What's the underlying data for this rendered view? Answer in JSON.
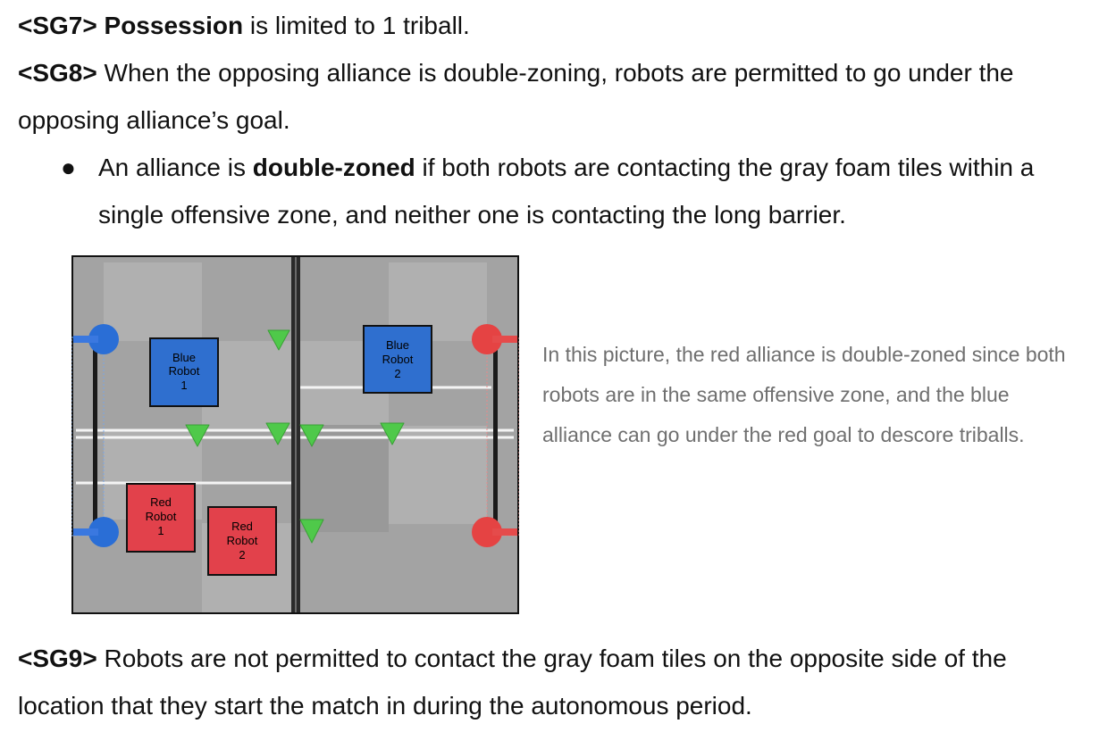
{
  "sg7": {
    "tag": "<SG7>",
    "term": "Possession",
    "text": " is limited to 1 triball."
  },
  "sg8": {
    "tag": "<SG8>",
    "text": " When the opposing alliance is double-zoning, robots are permitted to go under the opposing alliance’s goal."
  },
  "bullet": {
    "symbol": "●",
    "pre": "An alliance is ",
    "term": "double-zoned",
    "post": " if both robots are contacting the gray foam tiles within a single offensive zone, and neither one is contacting the long barrier."
  },
  "figure": {
    "robots": {
      "blue1": {
        "line1": "Blue",
        "line2": "Robot",
        "line3": "1",
        "color": "#2f6fcf"
      },
      "blue2": {
        "line1": "Blue",
        "line2": "Robot",
        "line3": "2",
        "color": "#2f6fcf"
      },
      "red1": {
        "line1": "Red",
        "line2": "Robot",
        "line3": "1",
        "color": "#e2414b"
      },
      "red2": {
        "line1": "Red",
        "line2": "Robot",
        "line3": "2",
        "color": "#e2414b"
      }
    },
    "colors": {
      "field": "#a4a4a4",
      "triball": "#4fc94a",
      "blue_goal": "#2a6ed6",
      "red_goal": "#e54343"
    }
  },
  "caption": "In this picture, the red alliance is double-zoned since both robots are in the same offensive zone, and the blue alliance can go under the red goal to descore triballs.",
  "sg9": {
    "tag": "<SG9>",
    "text": " Robots are not permitted to contact the gray foam tiles on the opposite side of the location that they start the match in during the autonomous period."
  }
}
